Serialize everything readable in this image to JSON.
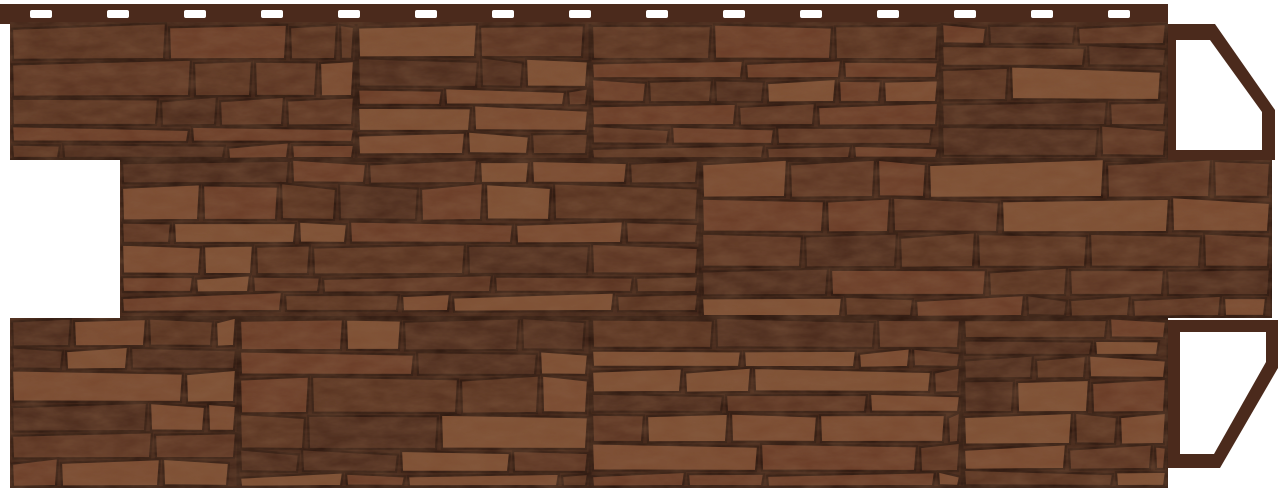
{
  "scene": {
    "subject": "stone-facade-panel",
    "background_color": "#ffffff",
    "colors": {
      "panel_base": "#4a2a1c",
      "stone_light": "#7a4a30",
      "stone_mid": "#5b3422",
      "stone_dark": "#3a1f14",
      "grout": "#2a160e",
      "flange": "#4b2a1c",
      "slot": "#ffffff"
    },
    "rows": [
      {
        "name": "top-row"
      },
      {
        "name": "middle-row"
      },
      {
        "name": "bottom-row"
      }
    ]
  }
}
